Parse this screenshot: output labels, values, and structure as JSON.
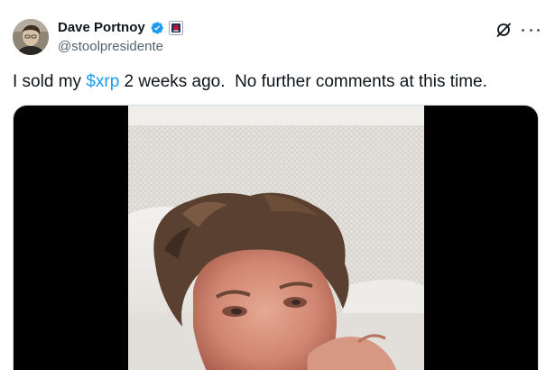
{
  "author": {
    "display_name": "Dave Portnoy",
    "handle": "@stoolpresidente",
    "verified_icon": "verified-badge-icon",
    "affiliate_icon": "affiliate-badge-icon",
    "verified_color": "#1d9bf0"
  },
  "tweet": {
    "text_before": "I sold my ",
    "cashtag": "$xrp",
    "text_after": " 2 weeks ago.  No further comments at this time."
  },
  "actions": {
    "grok_icon": "grok-icon",
    "more_icon": "more-icon"
  },
  "media": {
    "type": "video",
    "description_icon": "video-frame"
  },
  "colors": {
    "text": "#0f1419",
    "secondary": "#536471",
    "accent": "#1d9bf0"
  }
}
